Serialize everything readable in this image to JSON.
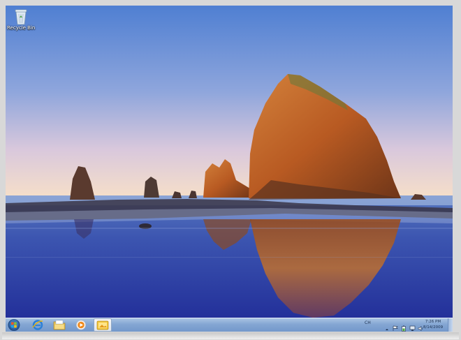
{
  "desktop": {
    "icons": [
      {
        "label": "Recycle Bin",
        "icon": "recycle-bin-icon"
      }
    ]
  },
  "taskbar": {
    "start_icon": "windows-start-orb",
    "pinned": [
      {
        "name": "internet-explorer",
        "icon": "ie-icon",
        "active": false
      },
      {
        "name": "windows-explorer",
        "icon": "folder-icon",
        "active": false
      },
      {
        "name": "media-player",
        "icon": "media-player-icon",
        "active": false
      },
      {
        "name": "photo-gallery",
        "icon": "photo-icon",
        "active": true
      }
    ],
    "tray": {
      "language": "CH",
      "icons": [
        "show-hidden-icon",
        "flag-icon",
        "battery-icon",
        "network-icon",
        "volume-icon"
      ],
      "time": "7:26 PM",
      "date": "8/14/2009"
    }
  },
  "colors": {
    "taskbar": "#84a6d3",
    "sky_top": "#5b86d4",
    "sky_bottom": "#f4dcc8",
    "rock": "#c5682a",
    "water": "#2a3d9a"
  }
}
